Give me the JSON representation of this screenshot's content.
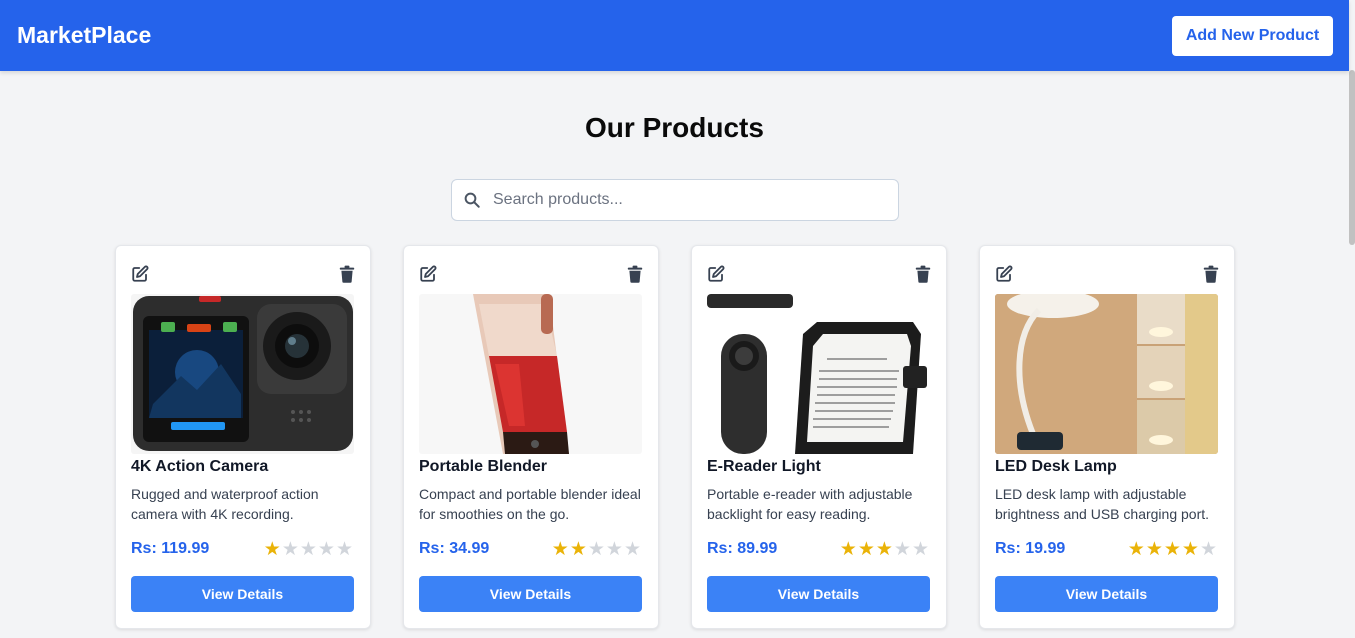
{
  "navbar": {
    "brand": "MarketPlace",
    "add_label": "Add New Product"
  },
  "page": {
    "title": "Our Products"
  },
  "search": {
    "placeholder": "Search products...",
    "icon": "search-icon"
  },
  "products": [
    {
      "name": "4K Action Camera",
      "description": "Rugged and waterproof action camera with 4K recording.",
      "price": "Rs: 119.99",
      "rating": 1,
      "max_rating": 5,
      "button_label": "View Details",
      "image": "action-camera-image"
    },
    {
      "name": "Portable Blender",
      "description": "Compact and portable blender ideal for smoothies on the go.",
      "price": "Rs: 34.99",
      "rating": 2,
      "max_rating": 5,
      "button_label": "View Details",
      "image": "blender-image"
    },
    {
      "name": "E-Reader Light",
      "description": "Portable e-reader with adjustable backlight for easy reading.",
      "price": "Rs: 89.99",
      "rating": 3,
      "max_rating": 5,
      "button_label": "View Details",
      "image": "ereader-light-image"
    },
    {
      "name": "LED Desk Lamp",
      "description": "LED desk lamp with adjustable brightness and USB charging port.",
      "price": "Rs: 19.99",
      "rating": 4,
      "max_rating": 5,
      "button_label": "View Details",
      "image": "desk-lamp-image"
    }
  ],
  "colors": {
    "primary": "#2563eb",
    "button": "#3b82f6",
    "star_on": "#eab308",
    "star_off": "#d1d5db",
    "background": "#f3f4f6"
  }
}
